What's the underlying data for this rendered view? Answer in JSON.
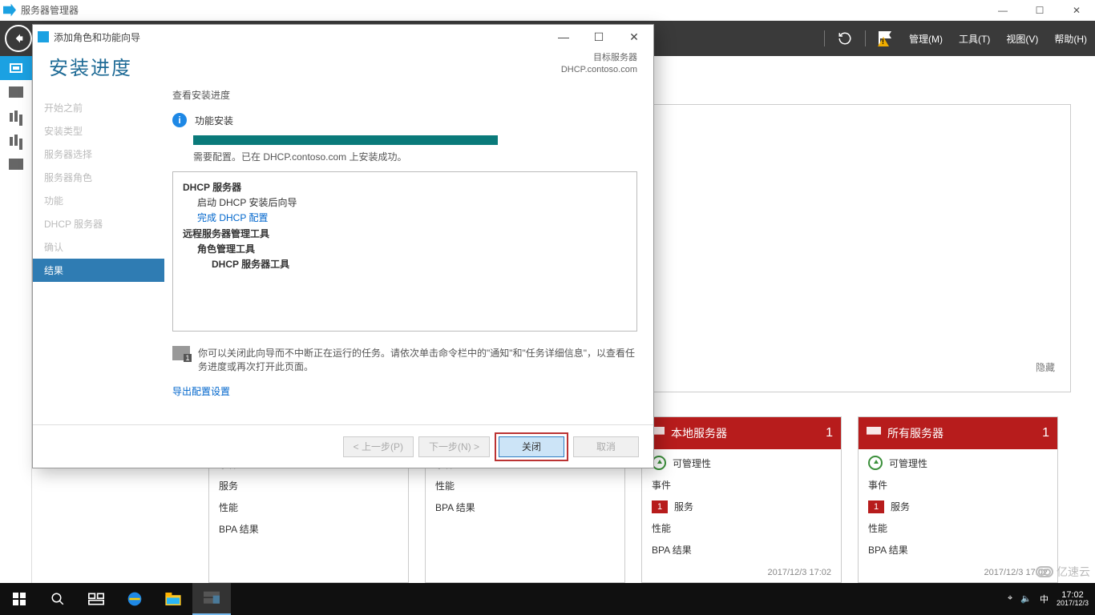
{
  "outer_window": {
    "title": "服务器管理器"
  },
  "sm_header": {
    "menus": {
      "manage": "管理(M)",
      "tools": "工具(T)",
      "view": "视图(V)",
      "help": "帮助(H)"
    }
  },
  "hide_link": "隐藏",
  "tiles": {
    "plain1": {
      "items": [
        "事件",
        "服务",
        "性能",
        "BPA 结果"
      ]
    },
    "plain2": {
      "items": [
        "事件",
        "性能",
        "BPA 结果"
      ]
    },
    "local": {
      "title": "本地服务器",
      "count": "1",
      "rows": {
        "manage": "可管理性",
        "events": "事件",
        "services": "服务",
        "perf": "性能",
        "bpa": "BPA 结果"
      },
      "svc_badge": "1",
      "timestamp": "2017/12/3 17:02"
    },
    "all": {
      "title": "所有服务器",
      "count": "1",
      "rows": {
        "manage": "可管理性",
        "events": "事件",
        "services": "服务",
        "perf": "性能",
        "bpa": "BPA 结果"
      },
      "svc_badge": "1",
      "timestamp": "2017/12/3 17:02"
    }
  },
  "dialog": {
    "title": "添加角色和功能向导",
    "heading": "安装进度",
    "target_label": "目标服务器",
    "target_value": "DHCP.contoso.com",
    "steps": [
      "开始之前",
      "安装类型",
      "服务器选择",
      "服务器角色",
      "功能",
      "DHCP 服务器",
      "确认",
      "结果"
    ],
    "active_step_index": 7,
    "pane": {
      "view_label": "查看安装进度",
      "status_text": "功能安装",
      "msg": "需要配置。已在 DHCP.contoso.com 上安装成功。",
      "box": {
        "l1": "DHCP 服务器",
        "l2": "启动 DHCP 安装后向导",
        "l3": "完成 DHCP 配置",
        "l4": "远程服务器管理工具",
        "l5": "角色管理工具",
        "l6": "DHCP 服务器工具"
      },
      "note": "你可以关闭此向导而不中断正在运行的任务。请依次单击命令栏中的\"通知\"和\"任务详细信息\"，以查看任务进度或再次打开此页面。",
      "export": "导出配置设置"
    },
    "buttons": {
      "prev": "< 上一步(P)",
      "next": "下一步(N) >",
      "close": "关闭",
      "cancel": "取消"
    }
  },
  "taskbar": {
    "clock": {
      "time": "17:02",
      "date": "2017/12/3"
    },
    "ime": "中"
  },
  "watermark": "亿速云"
}
